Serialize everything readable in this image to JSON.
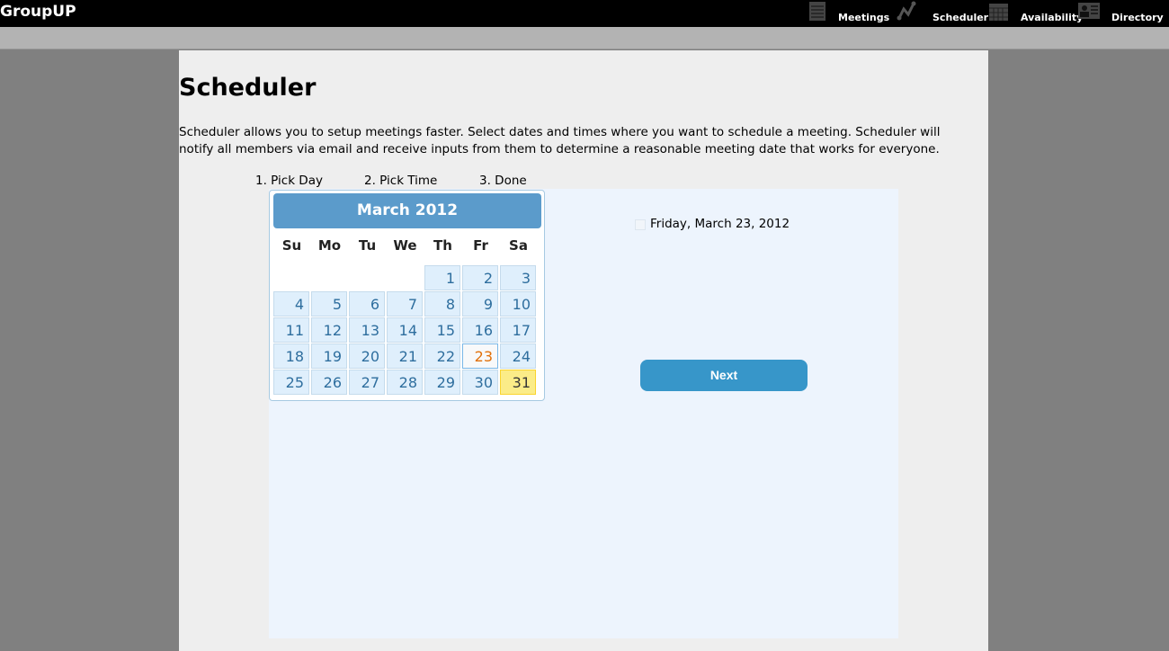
{
  "app": {
    "title": "GroupUP"
  },
  "nav": [
    {
      "label": "Meetings",
      "icon": "notepad-icon"
    },
    {
      "label": "Scheduler",
      "icon": "line-graph-icon"
    },
    {
      "label": "Availability",
      "icon": "calendar-icon"
    },
    {
      "label": "Directory",
      "icon": "contact-card-icon"
    }
  ],
  "page": {
    "title": "Scheduler",
    "description": "Scheduler allows you to setup meetings faster. Select dates and times where you want to schedule a meeting. Scheduler will notify all members via email and receive inputs from them to determine a reasonable meeting date that works for everyone."
  },
  "steps": [
    "1.  Pick Day",
    "2.  Pick Time",
    "3.  Done"
  ],
  "calendar": {
    "month_label": "March 2012",
    "weekdays": [
      "Su",
      "Mo",
      "Tu",
      "We",
      "Th",
      "Fr",
      "Sa"
    ],
    "weeks": [
      [
        null,
        null,
        null,
        null,
        1,
        2,
        3
      ],
      [
        4,
        5,
        6,
        7,
        8,
        9,
        10
      ],
      [
        11,
        12,
        13,
        14,
        15,
        16,
        17
      ],
      [
        18,
        19,
        20,
        21,
        22,
        23,
        24
      ],
      [
        25,
        26,
        27,
        28,
        29,
        30,
        31
      ]
    ],
    "highlighted_day": 23,
    "selected_day": 31
  },
  "selected_dates": [
    "Friday, March 23, 2012"
  ],
  "next_label": "Next",
  "colors": {
    "header": "#5b9bcb",
    "button": "#3796c9",
    "today": "#e17009",
    "selected": "#fbec88"
  }
}
